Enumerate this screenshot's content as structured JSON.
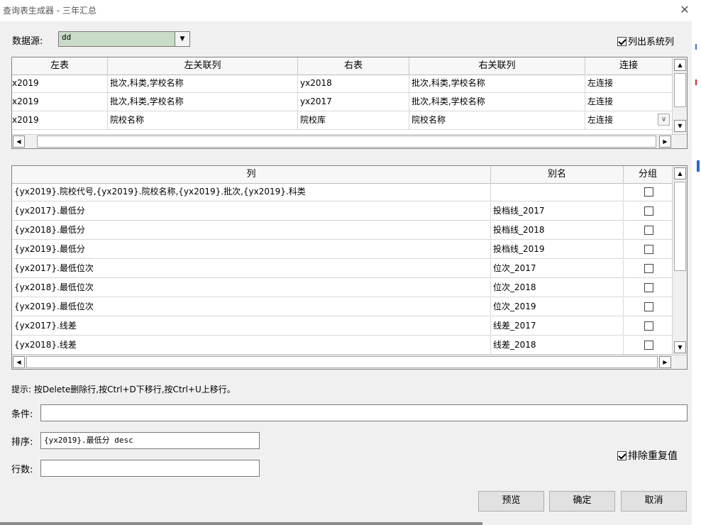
{
  "window": {
    "title": "查询表生成器 - 三年汇总",
    "close_glyph": "✕"
  },
  "datasource": {
    "label": "数据源:",
    "value": "dd",
    "show_system_columns_label": "列出系统列",
    "show_system_columns_checked": true
  },
  "join_grid": {
    "headers": [
      "左表",
      "左关联列",
      "右表",
      "右关联列",
      "连接"
    ],
    "rows": [
      {
        "left_table": "x2019",
        "left_cols": "批次,科类,学校名称",
        "right_table": "yx2018",
        "right_cols": "批次,科类,学校名称",
        "join": "左连接"
      },
      {
        "left_table": "x2019",
        "left_cols": "批次,科类,学校名称",
        "right_table": "yx2017",
        "right_cols": "批次,科类,学校名称",
        "join": "左连接"
      },
      {
        "left_table": "x2019",
        "left_cols": "院校名称",
        "right_table": "院校库",
        "right_cols": "院校名称",
        "join": "左连接"
      }
    ]
  },
  "column_grid": {
    "headers": [
      "列",
      "别名",
      "分组"
    ],
    "rows": [
      {
        "col": "{yx2019}.院校代号,{yx2019}.院校名称,{yx2019}.批次,{yx2019}.科类",
        "alias": "",
        "group": false
      },
      {
        "col": "{yx2017}.最低分",
        "alias": "投档线_2017",
        "group": false
      },
      {
        "col": "{yx2018}.最低分",
        "alias": "投档线_2018",
        "group": false
      },
      {
        "col": "{yx2019}.最低分",
        "alias": "投档线_2019",
        "group": false
      },
      {
        "col": "{yx2017}.最低位次",
        "alias": "位次_2017",
        "group": false
      },
      {
        "col": "{yx2018}.最低位次",
        "alias": "位次_2018",
        "group": false
      },
      {
        "col": "{yx2019}.最低位次",
        "alias": "位次_2019",
        "group": false
      },
      {
        "col": "{yx2017}.线差",
        "alias": "线差_2017",
        "group": false
      },
      {
        "col": "{yx2018}.线差",
        "alias": "线差_2018",
        "group": false
      }
    ]
  },
  "hint": "提示: 按Delete删除行,按Ctrl+D下移行,按Ctrl+U上移行。",
  "condition": {
    "label": "条件:",
    "value": ""
  },
  "sort": {
    "label": "排序:",
    "value": "{yx2019}.最低分 desc"
  },
  "rows_limit": {
    "label": "行数:",
    "value": ""
  },
  "distinct": {
    "label": "排除重复值",
    "checked": true
  },
  "buttons": {
    "preview": "预览",
    "ok": "确定",
    "cancel": "取消"
  },
  "scroll_glyphs": {
    "up": "▲",
    "down": "▼",
    "left": "◀",
    "right": "▶",
    "combo": "∨",
    "dropdown": "▼"
  }
}
